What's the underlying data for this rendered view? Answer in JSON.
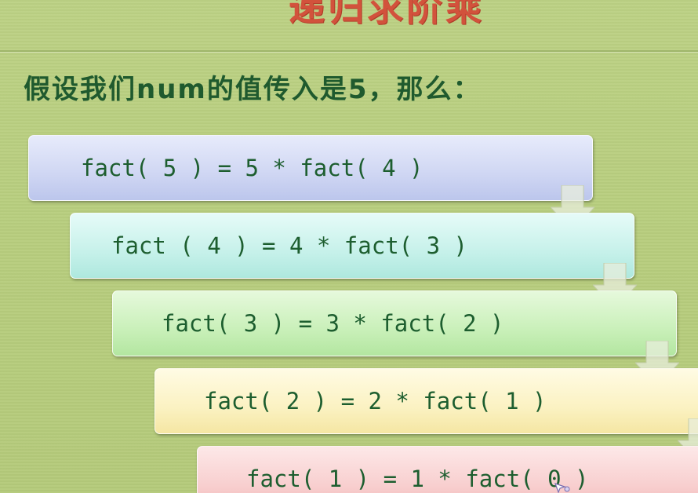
{
  "slide": {
    "title": "递归求阶乘",
    "intro": "假设我们num的值传入是5，那么：",
    "steps": [
      "fact( 5 ) = 5 * fact( 4 )",
      "fact ( 4 ) = 4 * fact( 3 )",
      "fact( 3 ) = 3 * fact( 2 )",
      "fact( 2 ) = 2 * fact( 1 )",
      "fact( 1 ) = 1 * fact( 0 )"
    ]
  },
  "colors": {
    "background": "#b8ce7e",
    "title": "#d2523c",
    "text": "#1d5e2f",
    "step_1": "#cfd6f3",
    "step_2": "#c6f1ea",
    "step_3": "#c9f0b9",
    "step_4": "#fbf2c2",
    "step_5": "#f8cfcf"
  },
  "icons": {
    "step_connector": "down-arrow-icon",
    "pointer": "mouse-cursor-icon"
  }
}
